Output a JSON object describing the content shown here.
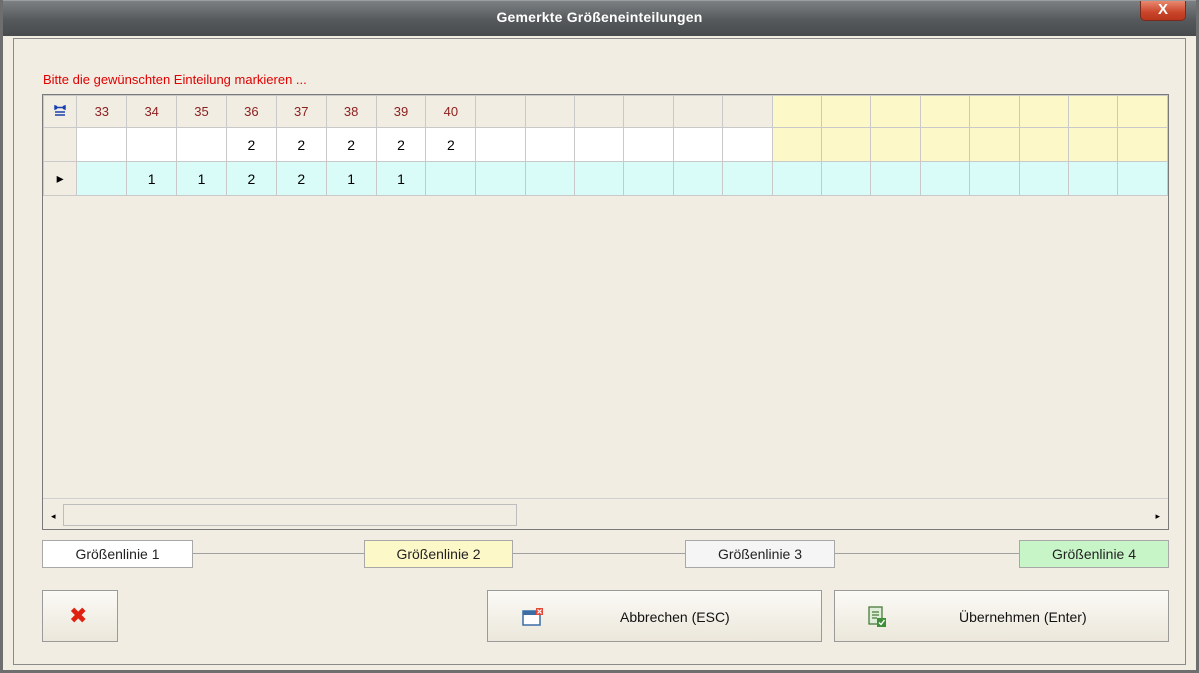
{
  "window": {
    "title": "Gemerkte Größeneinteilungen",
    "close_glyph": "X"
  },
  "hint": "Bitte die gewünschten Einteilung markieren ...",
  "grid": {
    "header_icon": "column-resize-icon",
    "header": [
      "33",
      "34",
      "35",
      "36",
      "37",
      "38",
      "39",
      "40",
      "",
      "",
      "",
      "",
      "",
      "",
      "",
      "",
      "",
      "",
      "",
      "",
      "",
      ""
    ],
    "rows": [
      {
        "marker": "",
        "cells": [
          "",
          "",
          "",
          "2",
          "2",
          "2",
          "2",
          "2",
          "",
          "",
          "",
          "",
          "",
          "",
          "",
          "",
          "",
          "",
          "",
          "",
          "",
          ""
        ]
      },
      {
        "marker": "▸",
        "cells": [
          "",
          "1",
          "1",
          "2",
          "2",
          "1",
          "1",
          "",
          "",
          "",
          "",
          "",
          "",
          "",
          "",
          "",
          "",
          "",
          "",
          "",
          "",
          ""
        ]
      }
    ]
  },
  "scrollbar": {
    "left_arrow": "◂",
    "right_arrow": "▸"
  },
  "size_lines": [
    {
      "label": "Größenlinie 1",
      "color": "#ffffff"
    },
    {
      "label": "Größenlinie 2",
      "color": "#fdf8c8"
    },
    {
      "label": "Größenlinie 3",
      "color": "#f5f5f5"
    },
    {
      "label": "Größenlinie 4",
      "color": "#c8f5c8"
    }
  ],
  "buttons": {
    "delete_glyph": "✖",
    "cancel_label": "Abbrechen (ESC)",
    "accept_label": "Übernehmen (Enter)"
  },
  "colors": {
    "header_text": "#8b1e1e",
    "hint_text": "#e00000",
    "selected_row": "#dafcf8",
    "yellow_block": "#fdf8c8"
  }
}
